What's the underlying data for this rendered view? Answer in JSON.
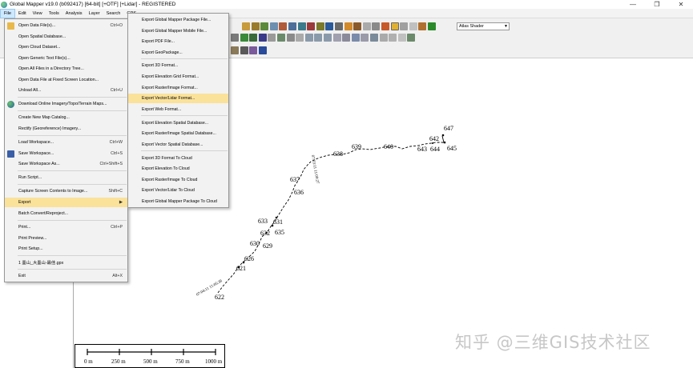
{
  "window": {
    "title": "Global Mapper v19.0 (b092417) [64-bit] [+OTF] [+Lidar] - REGISTERED",
    "minimize": "—",
    "maximize": "❐",
    "close": "✕"
  },
  "menubar": [
    "File",
    "Edit",
    "View",
    "Tools",
    "Analysis",
    "Layer",
    "Search",
    "GPS"
  ],
  "toolbar": {
    "shader_value": "Atlas Shader"
  },
  "file_menu": [
    {
      "label": "Open Data File(s)...",
      "shortcut": "Ctrl+O",
      "icon": "folder-icon"
    },
    {
      "label": "Open Spatial Database...",
      "shortcut": ""
    },
    {
      "label": "Open Cloud Dataset...",
      "shortcut": ""
    },
    {
      "label": "Open Generic Text File(s)...",
      "shortcut": ""
    },
    {
      "label": "Open All Files in a Directory Tree...",
      "shortcut": ""
    },
    {
      "label": "Open Data File at Fixed Screen Location...",
      "shortcut": ""
    },
    {
      "label": "Unload All...",
      "shortcut": "Ctrl+U"
    },
    {
      "label": "Download Online Imagery/Topo/Terrain Maps...",
      "shortcut": "",
      "icon": "globe-icon"
    },
    {
      "label": "Create New Map Catalog...",
      "shortcut": ""
    },
    {
      "label": "Rectify (Georeference) Imagery...",
      "shortcut": ""
    },
    {
      "label": "Load Workspace...",
      "shortcut": "Ctrl+W"
    },
    {
      "label": "Save Workspace...",
      "shortcut": "Ctrl+S",
      "icon": "save-icon"
    },
    {
      "label": "Save Workspace As...",
      "shortcut": "Ctrl+Shift+S"
    },
    {
      "label": "Run Script...",
      "shortcut": ""
    },
    {
      "label": "Capture Screen Contents to Image...",
      "shortcut": "Shift+C"
    },
    {
      "label": "Export",
      "shortcut": "▶"
    },
    {
      "label": "Batch Convert/Reproject...",
      "shortcut": ""
    },
    {
      "label": "Print...",
      "shortcut": "Ctrl+P"
    },
    {
      "label": "Print Preview...",
      "shortcut": ""
    },
    {
      "label": "Print Setup...",
      "shortcut": ""
    },
    {
      "label": "1 墨山_大墨山-最佳.gpx",
      "shortcut": ""
    },
    {
      "label": "Exit",
      "shortcut": "Alt+X"
    }
  ],
  "export_menu": [
    "Export Global Mapper Package File...",
    "Export Global Mapper Mobile File...",
    "Export PDF File...",
    "Export GeoPackage...",
    "Export 3D Format...",
    "Export Elevation Grid Format...",
    "Export Raster/Image Format...",
    "Export Vector/Lidar Format...",
    "Export Web Format...",
    "Export Elevation Spatial Database...",
    "Export Raster/Image Spatial Database...",
    "Export Vector Spatial Database...",
    "Export 3D Format To Cloud",
    "Export Elevation To Cloud",
    "Export Raster/Image To Cloud",
    "Export Vector/Lidar To Cloud",
    "Export Global Mapper Package To Cloud"
  ],
  "map": {
    "point_labels": [
      "647",
      "642",
      "645",
      "644",
      "643",
      "640",
      "639",
      "638",
      "637",
      "636",
      "633",
      "631",
      "632",
      "635",
      "630",
      "629",
      "626",
      "621",
      "622"
    ],
    "side_labels": [
      "07:03:11 11:09:27",
      "07:04:11 11:05:36"
    ]
  },
  "scalebar": {
    "labels": [
      "0 m",
      "250 m",
      "500 m",
      "750 m",
      "1000 m"
    ]
  },
  "watermark": "知乎 @三维GIS技术社区",
  "colors": {
    "menu_highlight": "#fbe29a",
    "menu_bg": "#f2f2f2",
    "track": "#000000"
  }
}
